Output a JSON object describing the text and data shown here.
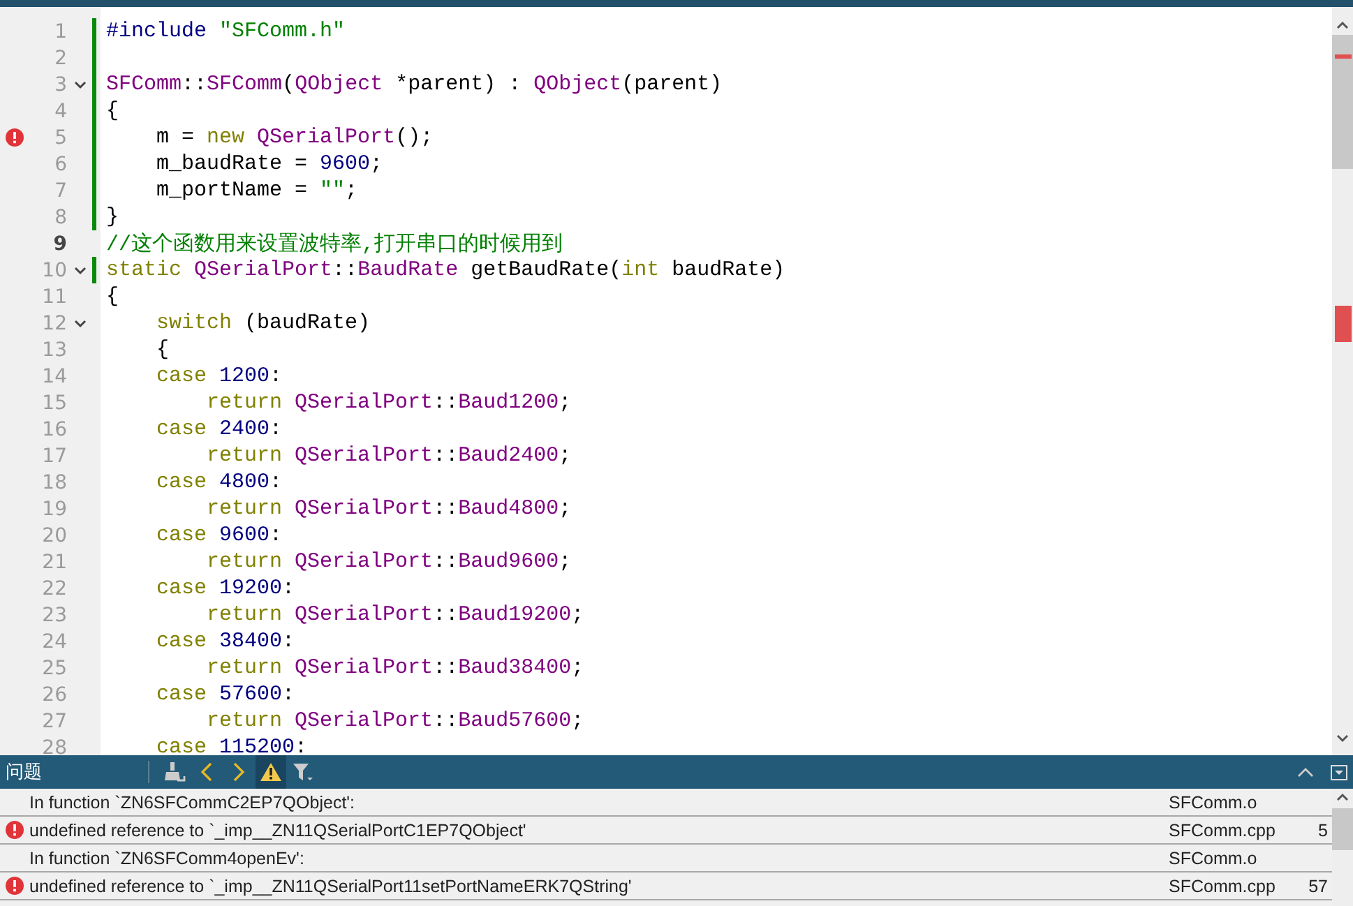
{
  "editor": {
    "lines": [
      {
        "number": "1",
        "error": false,
        "modified": true,
        "foldable": false,
        "current": false,
        "tokens": [
          {
            "kind": "preprocessor",
            "text": "#include "
          },
          {
            "kind": "string",
            "text": "\"SFComm.h\""
          }
        ]
      },
      {
        "number": "2",
        "error": false,
        "modified": true,
        "foldable": false,
        "current": false
      },
      {
        "number": "3",
        "error": false,
        "modified": true,
        "foldable": true,
        "current": false,
        "tokens": [
          {
            "kind": "type",
            "text": "SFComm"
          },
          {
            "kind": "plain",
            "text": "::"
          },
          {
            "kind": "type",
            "text": "SFComm"
          },
          {
            "kind": "plain",
            "text": "("
          },
          {
            "kind": "type",
            "text": "QObject"
          },
          {
            "kind": "plain",
            "text": " *parent) : "
          },
          {
            "kind": "type",
            "text": "QObject"
          },
          {
            "kind": "plain",
            "text": "(parent)"
          }
        ]
      },
      {
        "number": "4",
        "error": false,
        "modified": true,
        "foldable": false,
        "current": false,
        "tokens": [
          {
            "kind": "plain",
            "text": "{"
          }
        ]
      },
      {
        "number": "5",
        "error": true,
        "modified": true,
        "foldable": false,
        "current": false,
        "tokens": [
          {
            "kind": "plain",
            "text": "    m = "
          },
          {
            "kind": "keyword",
            "text": "new "
          },
          {
            "kind": "type",
            "text": "QSerialPort"
          },
          {
            "kind": "plain",
            "text": "();"
          }
        ]
      },
      {
        "number": "6",
        "error": false,
        "modified": true,
        "foldable": false,
        "current": false,
        "tokens": [
          {
            "kind": "plain",
            "text": "    m_baudRate = "
          },
          {
            "kind": "number",
            "text": "9600"
          },
          {
            "kind": "plain",
            "text": ";"
          }
        ]
      },
      {
        "number": "7",
        "error": false,
        "modified": true,
        "foldable": false,
        "current": false,
        "tokens": [
          {
            "kind": "plain",
            "text": "    m_portName = "
          },
          {
            "kind": "string",
            "text": "\"\""
          },
          {
            "kind": "plain",
            "text": ";"
          }
        ]
      },
      {
        "number": "8",
        "error": false,
        "modified": true,
        "foldable": false,
        "current": false,
        "tokens": [
          {
            "kind": "plain",
            "text": "}"
          }
        ]
      },
      {
        "number": "9",
        "error": false,
        "modified": false,
        "foldable": false,
        "current": true,
        "tokens": [
          {
            "kind": "comment",
            "text": "//这个函数用来设置波特率,打开串口的时候用到"
          }
        ]
      },
      {
        "number": "10",
        "error": false,
        "modified": true,
        "foldable": true,
        "current": false,
        "tokens": [
          {
            "kind": "keyword",
            "text": "static "
          },
          {
            "kind": "type",
            "text": "QSerialPort"
          },
          {
            "kind": "plain",
            "text": "::"
          },
          {
            "kind": "type",
            "text": "BaudRate"
          },
          {
            "kind": "plain",
            "text": " getBaudRate("
          },
          {
            "kind": "keyword",
            "text": "int"
          },
          {
            "kind": "plain",
            "text": " baudRate)"
          }
        ]
      },
      {
        "number": "11",
        "error": false,
        "modified": false,
        "foldable": false,
        "current": false,
        "tokens": [
          {
            "kind": "plain",
            "text": "{"
          }
        ]
      },
      {
        "number": "12",
        "error": false,
        "modified": false,
        "foldable": true,
        "current": false,
        "tokens": [
          {
            "kind": "keyword",
            "text": "    switch"
          },
          {
            "kind": "plain",
            "text": " (baudRate)"
          }
        ]
      },
      {
        "number": "13",
        "error": false,
        "modified": false,
        "foldable": false,
        "current": false,
        "tokens": [
          {
            "kind": "plain",
            "text": "    {"
          }
        ]
      },
      {
        "number": "14",
        "error": false,
        "modified": false,
        "foldable": false,
        "current": false,
        "tokens": [
          {
            "kind": "keyword",
            "text": "    case "
          },
          {
            "kind": "number",
            "text": "1200"
          },
          {
            "kind": "plain",
            "text": ":"
          }
        ]
      },
      {
        "number": "15",
        "error": false,
        "modified": false,
        "foldable": false,
        "current": false,
        "tokens": [
          {
            "kind": "keyword",
            "text": "        return "
          },
          {
            "kind": "type",
            "text": "QSerialPort"
          },
          {
            "kind": "plain",
            "text": "::"
          },
          {
            "kind": "type",
            "text": "Baud1200"
          },
          {
            "kind": "plain",
            "text": ";"
          }
        ]
      },
      {
        "number": "16",
        "error": false,
        "modified": false,
        "foldable": false,
        "current": false,
        "tokens": [
          {
            "kind": "keyword",
            "text": "    case "
          },
          {
            "kind": "number",
            "text": "2400"
          },
          {
            "kind": "plain",
            "text": ":"
          }
        ]
      },
      {
        "number": "17",
        "error": false,
        "modified": false,
        "foldable": false,
        "current": false,
        "tokens": [
          {
            "kind": "keyword",
            "text": "        return "
          },
          {
            "kind": "type",
            "text": "QSerialPort"
          },
          {
            "kind": "plain",
            "text": "::"
          },
          {
            "kind": "type",
            "text": "Baud2400"
          },
          {
            "kind": "plain",
            "text": ";"
          }
        ]
      },
      {
        "number": "18",
        "error": false,
        "modified": false,
        "foldable": false,
        "current": false,
        "tokens": [
          {
            "kind": "keyword",
            "text": "    case "
          },
          {
            "kind": "number",
            "text": "4800"
          },
          {
            "kind": "plain",
            "text": ":"
          }
        ]
      },
      {
        "number": "19",
        "error": false,
        "modified": false,
        "foldable": false,
        "current": false,
        "tokens": [
          {
            "kind": "keyword",
            "text": "        return "
          },
          {
            "kind": "type",
            "text": "QSerialPort"
          },
          {
            "kind": "plain",
            "text": "::"
          },
          {
            "kind": "type",
            "text": "Baud4800"
          },
          {
            "kind": "plain",
            "text": ";"
          }
        ]
      },
      {
        "number": "20",
        "error": false,
        "modified": false,
        "foldable": false,
        "current": false,
        "tokens": [
          {
            "kind": "keyword",
            "text": "    case "
          },
          {
            "kind": "number",
            "text": "9600"
          },
          {
            "kind": "plain",
            "text": ":"
          }
        ]
      },
      {
        "number": "21",
        "error": false,
        "modified": false,
        "foldable": false,
        "current": false,
        "tokens": [
          {
            "kind": "keyword",
            "text": "        return "
          },
          {
            "kind": "type",
            "text": "QSerialPort"
          },
          {
            "kind": "plain",
            "text": "::"
          },
          {
            "kind": "type",
            "text": "Baud9600"
          },
          {
            "kind": "plain",
            "text": ";"
          }
        ]
      },
      {
        "number": "22",
        "error": false,
        "modified": false,
        "foldable": false,
        "current": false,
        "tokens": [
          {
            "kind": "keyword",
            "text": "    case "
          },
          {
            "kind": "number",
            "text": "19200"
          },
          {
            "kind": "plain",
            "text": ":"
          }
        ]
      },
      {
        "number": "23",
        "error": false,
        "modified": false,
        "foldable": false,
        "current": false,
        "tokens": [
          {
            "kind": "keyword",
            "text": "        return "
          },
          {
            "kind": "type",
            "text": "QSerialPort"
          },
          {
            "kind": "plain",
            "text": "::"
          },
          {
            "kind": "type",
            "text": "Baud19200"
          },
          {
            "kind": "plain",
            "text": ";"
          }
        ]
      },
      {
        "number": "24",
        "error": false,
        "modified": false,
        "foldable": false,
        "current": false,
        "tokens": [
          {
            "kind": "keyword",
            "text": "    case "
          },
          {
            "kind": "number",
            "text": "38400"
          },
          {
            "kind": "plain",
            "text": ":"
          }
        ]
      },
      {
        "number": "25",
        "error": false,
        "modified": false,
        "foldable": false,
        "current": false,
        "tokens": [
          {
            "kind": "keyword",
            "text": "        return "
          },
          {
            "kind": "type",
            "text": "QSerialPort"
          },
          {
            "kind": "plain",
            "text": "::"
          },
          {
            "kind": "type",
            "text": "Baud38400"
          },
          {
            "kind": "plain",
            "text": ";"
          }
        ]
      },
      {
        "number": "26",
        "error": false,
        "modified": false,
        "foldable": false,
        "current": false,
        "tokens": [
          {
            "kind": "keyword",
            "text": "    case "
          },
          {
            "kind": "number",
            "text": "57600"
          },
          {
            "kind": "plain",
            "text": ":"
          }
        ]
      },
      {
        "number": "27",
        "error": false,
        "modified": false,
        "foldable": false,
        "current": false,
        "tokens": [
          {
            "kind": "keyword",
            "text": "        return "
          },
          {
            "kind": "type",
            "text": "QSerialPort"
          },
          {
            "kind": "plain",
            "text": "::"
          },
          {
            "kind": "type",
            "text": "Baud57600"
          },
          {
            "kind": "plain",
            "text": ";"
          }
        ]
      },
      {
        "number": "28",
        "error": false,
        "modified": false,
        "foldable": false,
        "current": false,
        "tokens": [
          {
            "kind": "keyword",
            "text": "    case "
          },
          {
            "kind": "number",
            "text": "115200"
          },
          {
            "kind": "plain",
            "text": ":"
          }
        ]
      }
    ]
  },
  "panel": {
    "title": "问题",
    "tool_buttons": [
      {
        "kind": "clean",
        "on": false
      },
      {
        "kind": "prev",
        "on": false
      },
      {
        "kind": "next",
        "on": false
      },
      {
        "kind": "warnings",
        "on": true
      },
      {
        "kind": "filter",
        "on": false
      }
    ],
    "rows": [
      {
        "kind": "info",
        "description": "In function `ZN6SFCommC2EP7QObject':",
        "file": "SFComm.o"
      },
      {
        "kind": "error",
        "description": "undefined reference to `_imp__ZN11QSerialPortC1EP7QObject'",
        "file": "SFComm.cpp",
        "line": "5"
      },
      {
        "kind": "info",
        "description": "In function `ZN6SFComm4openEv':",
        "file": "SFComm.o"
      },
      {
        "kind": "error",
        "description": "undefined reference to `_imp__ZN11QSerialPort11setPortNameERK7QString'",
        "file": "SFComm.cpp",
        "line": "57"
      }
    ]
  }
}
